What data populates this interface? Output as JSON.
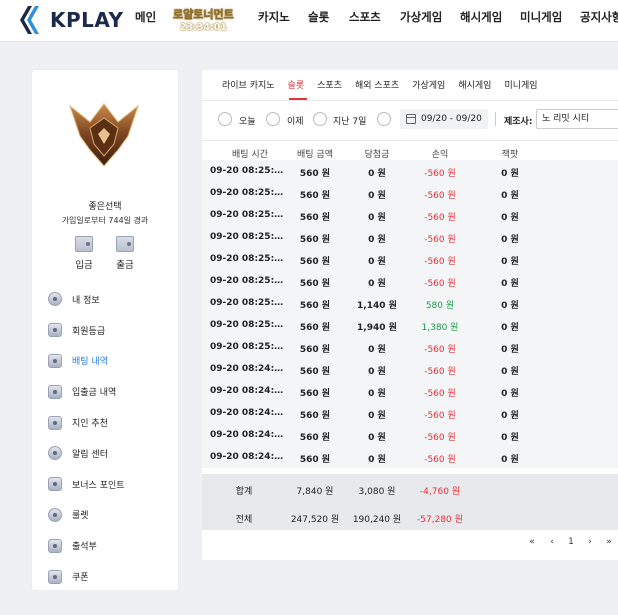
{
  "header": {
    "logo_text": "KPLAY",
    "nav": [
      {
        "label": "메인"
      },
      {
        "label_big": "로얄토너먼트",
        "label_small": "23:34:01"
      },
      {
        "label": "카지노"
      },
      {
        "label": "슬롯"
      },
      {
        "label": "스포츠"
      },
      {
        "label": "가상게임"
      },
      {
        "label": "해시게임"
      },
      {
        "label": "미니게임"
      },
      {
        "label": "공지사항"
      }
    ]
  },
  "sidebar": {
    "username": "좋은선택",
    "username_sub": "가입일로부터 744일 경과",
    "deposit_label": "입금",
    "withdraw_label": "출금",
    "menu": [
      {
        "label": "내 정보",
        "icon": "user-icon"
      },
      {
        "label": "회원등급",
        "icon": "rank-icon"
      },
      {
        "label": "배팅 내역",
        "icon": "bet-history-icon",
        "active": true
      },
      {
        "label": "입출금 내역",
        "icon": "transaction-icon"
      },
      {
        "label": "지인 추천",
        "icon": "referral-icon"
      },
      {
        "label": "알림 센터",
        "icon": "bell-icon"
      },
      {
        "label": "보너스 포인트",
        "icon": "bonus-icon"
      },
      {
        "label": "룰렛",
        "icon": "roulette-icon"
      },
      {
        "label": "출석부",
        "icon": "attendance-icon"
      },
      {
        "label": "쿠폰",
        "icon": "coupon-icon"
      }
    ]
  },
  "main": {
    "tabs": [
      "라이브 카지노",
      "슬롯",
      "스포츠",
      "해외 스포츠",
      "가상게임",
      "해시게임",
      "미니게임"
    ],
    "active_tab": "슬롯",
    "filter": {
      "today": "오늘",
      "yesterday": "이제",
      "last7": "지난 7일",
      "date_range": "09/20 - 09/20",
      "provider_label": "제조사:",
      "provider_value": "노 리밋 시티"
    },
    "table": {
      "headers": [
        "배팅 시간",
        "배팅 금액",
        "당첨금",
        "손익",
        "잭팟"
      ],
      "rows": [
        {
          "time": "09-20 08:25:…",
          "bet": "560 원",
          "win": "0 원",
          "pnl": "-560 원",
          "jackpot": "0 원",
          "pnl_type": "neg"
        },
        {
          "time": "09-20 08:25:…",
          "bet": "560 원",
          "win": "0 원",
          "pnl": "-560 원",
          "jackpot": "0 원",
          "pnl_type": "neg"
        },
        {
          "time": "09-20 08:25:…",
          "bet": "560 원",
          "win": "0 원",
          "pnl": "-560 원",
          "jackpot": "0 원",
          "pnl_type": "neg"
        },
        {
          "time": "09-20 08:25:…",
          "bet": "560 원",
          "win": "0 원",
          "pnl": "-560 원",
          "jackpot": "0 원",
          "pnl_type": "neg"
        },
        {
          "time": "09-20 08:25:…",
          "bet": "560 원",
          "win": "0 원",
          "pnl": "-560 원",
          "jackpot": "0 원",
          "pnl_type": "neg"
        },
        {
          "time": "09-20 08:25:…",
          "bet": "560 원",
          "win": "0 원",
          "pnl": "-560 원",
          "jackpot": "0 원",
          "pnl_type": "neg"
        },
        {
          "time": "09-20 08:25:…",
          "bet": "560 원",
          "win": "1,140 원",
          "pnl": "580 원",
          "jackpot": "0 원",
          "pnl_type": "pos"
        },
        {
          "time": "09-20 08:25:…",
          "bet": "560 원",
          "win": "1,940 원",
          "pnl": "1,380 원",
          "jackpot": "0 원",
          "pnl_type": "pos"
        },
        {
          "time": "09-20 08:25:…",
          "bet": "560 원",
          "win": "0 원",
          "pnl": "-560 원",
          "jackpot": "0 원",
          "pnl_type": "neg"
        },
        {
          "time": "09-20 08:24:…",
          "bet": "560 원",
          "win": "0 원",
          "pnl": "-560 원",
          "jackpot": "0 원",
          "pnl_type": "neg"
        },
        {
          "time": "09-20 08:24:…",
          "bet": "560 원",
          "win": "0 원",
          "pnl": "-560 원",
          "jackpot": "0 원",
          "pnl_type": "neg"
        },
        {
          "time": "09-20 08:24:…",
          "bet": "560 원",
          "win": "0 원",
          "pnl": "-560 원",
          "jackpot": "0 원",
          "pnl_type": "neg"
        },
        {
          "time": "09-20 08:24:…",
          "bet": "560 원",
          "win": "0 원",
          "pnl": "-560 원",
          "jackpot": "0 원",
          "pnl_type": "neg"
        },
        {
          "time": "09-20 08:24:…",
          "bet": "560 원",
          "win": "0 원",
          "pnl": "-560 원",
          "jackpot": "0 원",
          "pnl_type": "neg"
        }
      ],
      "subtotal": {
        "label": "합계",
        "bet": "7,840 원",
        "win": "3,080 원",
        "pnl": "-4,760 원"
      },
      "total": {
        "label": "전체",
        "bet": "247,520 원",
        "win": "190,240 원",
        "pnl": "-57,280 원"
      }
    },
    "pagination": {
      "first": "«",
      "prev": "‹",
      "page": "1",
      "next": "›",
      "last": "»"
    },
    "colors": {
      "accent": "#e0333a",
      "positive": "#1a9a4a",
      "active_menu": "#2a7de1"
    }
  }
}
